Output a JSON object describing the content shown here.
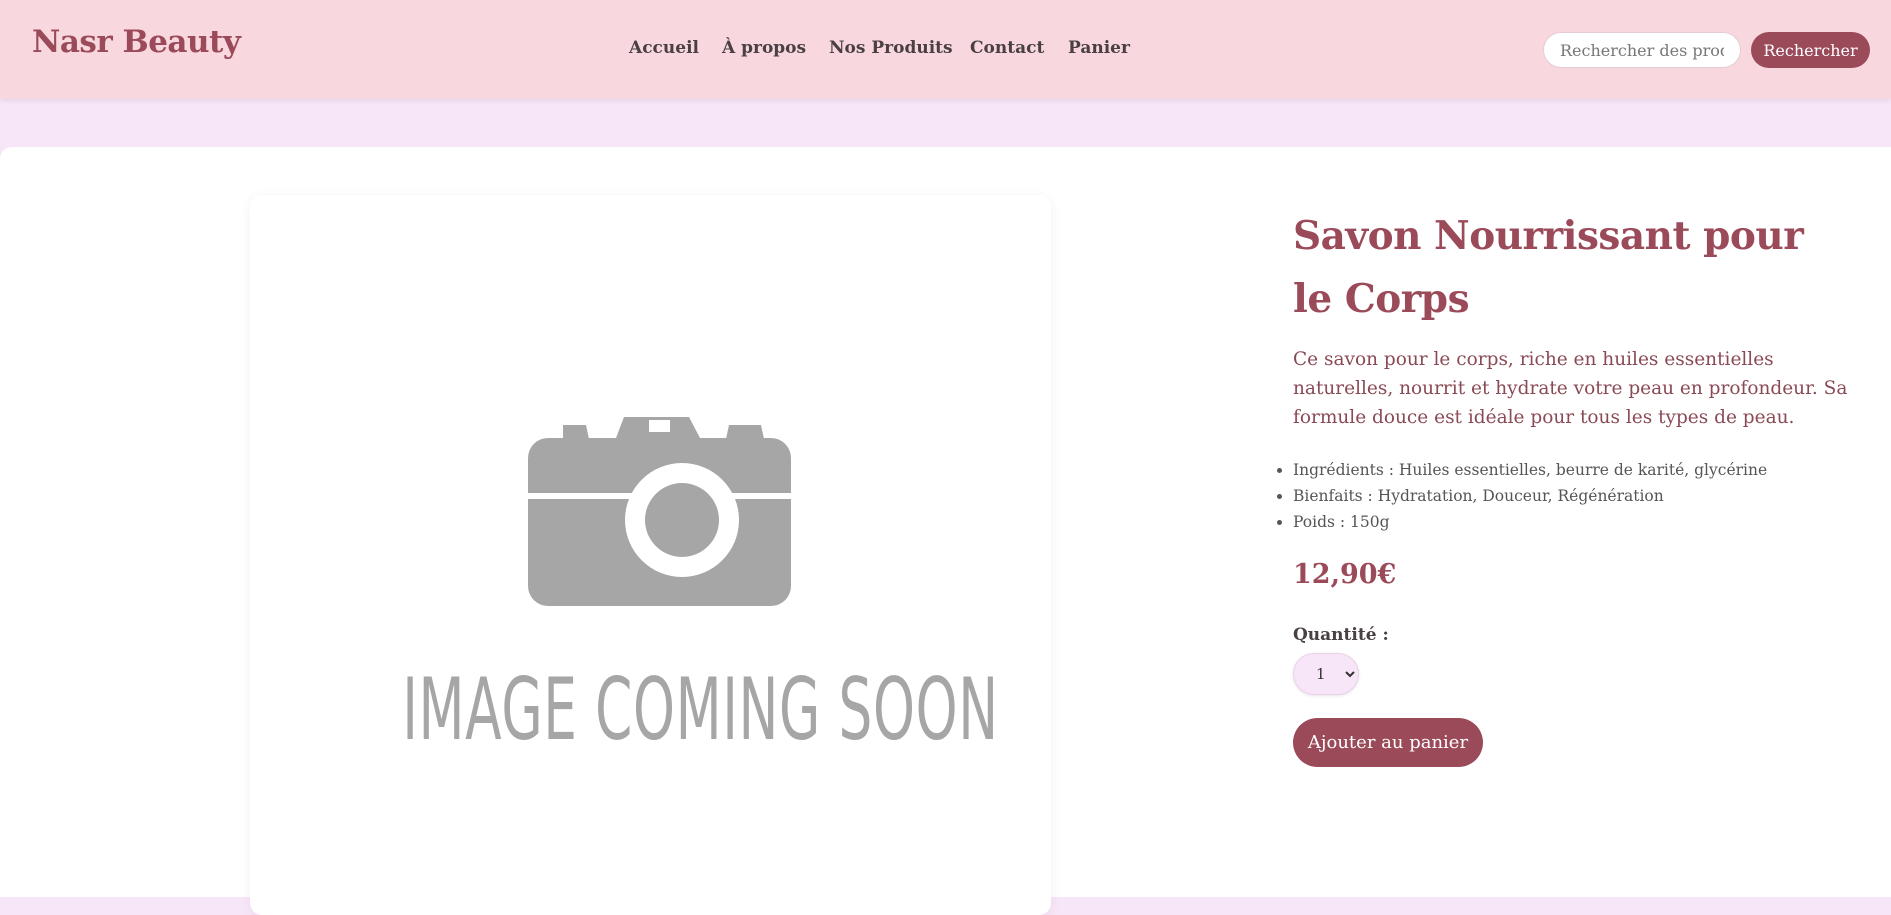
{
  "header": {
    "brand": "Nasr Beauty",
    "nav": [
      "Accueil",
      "À propos",
      "Nos Produits",
      "Contact",
      "Panier"
    ],
    "search": {
      "placeholder": "Rechercher des produits",
      "button_label": "Rechercher"
    },
    "background": "#f8d7df"
  },
  "product": {
    "image_text": "IMAGE COMING SOON",
    "image_icon": "camera-icon",
    "title": "Savon Nourrissant pour le Corps",
    "description": "Ce savon pour le corps, riche en huiles essentielles naturelles, nourrit et hydrate votre peau en profondeur. Sa formule douce est idéale pour tous les types de peau.",
    "features": [
      "Ingrédients : Huiles essentielles, beurre de karité, glycérine",
      "Bienfaits : Hydratation, Douceur, Régénération",
      "Poids : 150g"
    ],
    "price": "12,90€",
    "quantity_label": "Quantité :",
    "quantity_value": "1",
    "add_to_cart_label": "Ajouter au panier"
  },
  "colors": {
    "accent": "#9b4a59",
    "page_background": "#f7e6f8",
    "placeholder_gray": "#a6a6a6"
  }
}
